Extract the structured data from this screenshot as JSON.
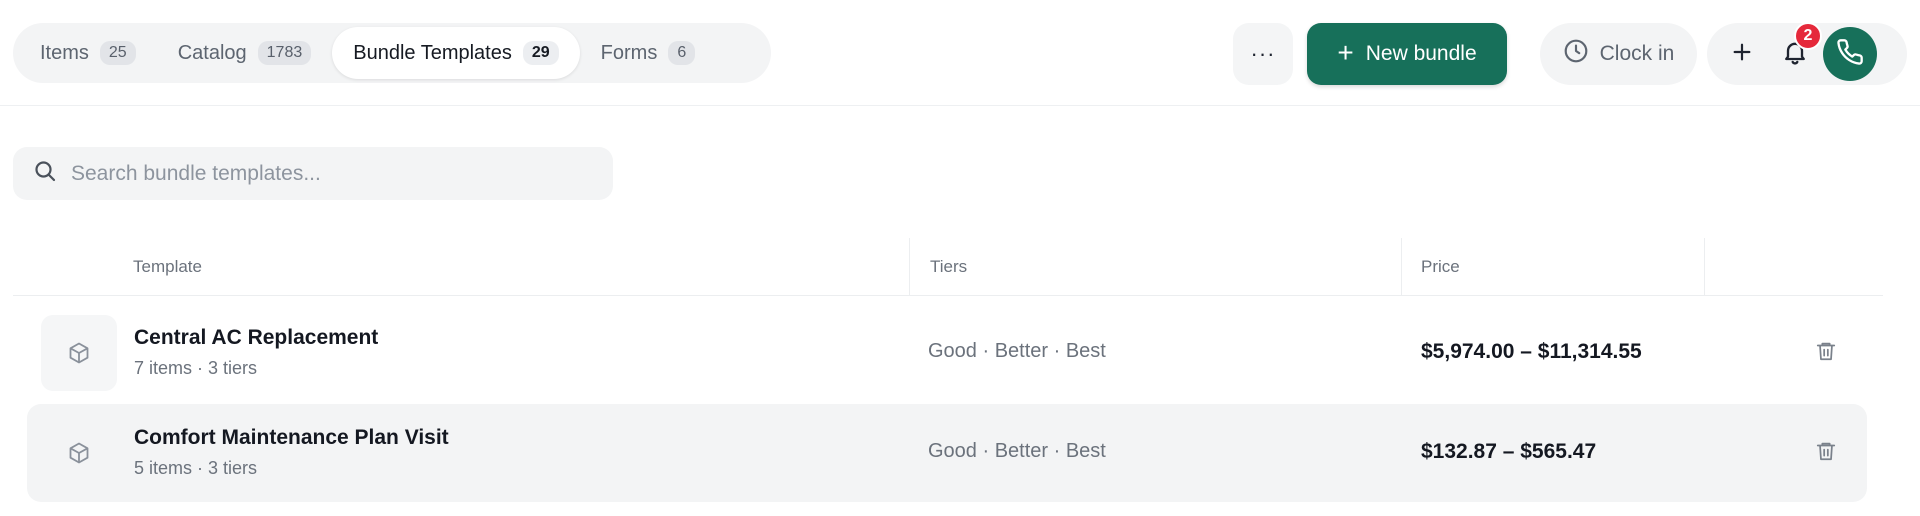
{
  "tabs": [
    {
      "label": "Items",
      "count": "25"
    },
    {
      "label": "Catalog",
      "count": "1783"
    },
    {
      "label": "Bundle Templates",
      "count": "29"
    },
    {
      "label": "Forms",
      "count": "6"
    }
  ],
  "toolbar": {
    "more_label": "···",
    "new_bundle_label": "New bundle",
    "clock_in_label": "Clock in",
    "notification_count": "2"
  },
  "search": {
    "placeholder": "Search bundle templates..."
  },
  "table": {
    "headers": {
      "template": "Template",
      "tiers": "Tiers",
      "price": "Price"
    },
    "rows": [
      {
        "title": "Central AC Replacement",
        "subtitle": "7 items · 3 tiers",
        "tiers": "Good · Better · Best",
        "price": "$5,974.00 – $11,314.55"
      },
      {
        "title": "Comfort Maintenance Plan Visit",
        "subtitle": "5 items · 3 tiers",
        "tiers": "Good · Better · Best",
        "price": "$132.87 – $565.47"
      }
    ]
  },
  "colors": {
    "brand": "#17705a",
    "badge": "#e5293b"
  },
  "icons": [
    "more-icon",
    "plus-icon",
    "clock-icon",
    "bell-icon",
    "phone-icon",
    "search-icon",
    "package-icon",
    "trash-icon"
  ]
}
